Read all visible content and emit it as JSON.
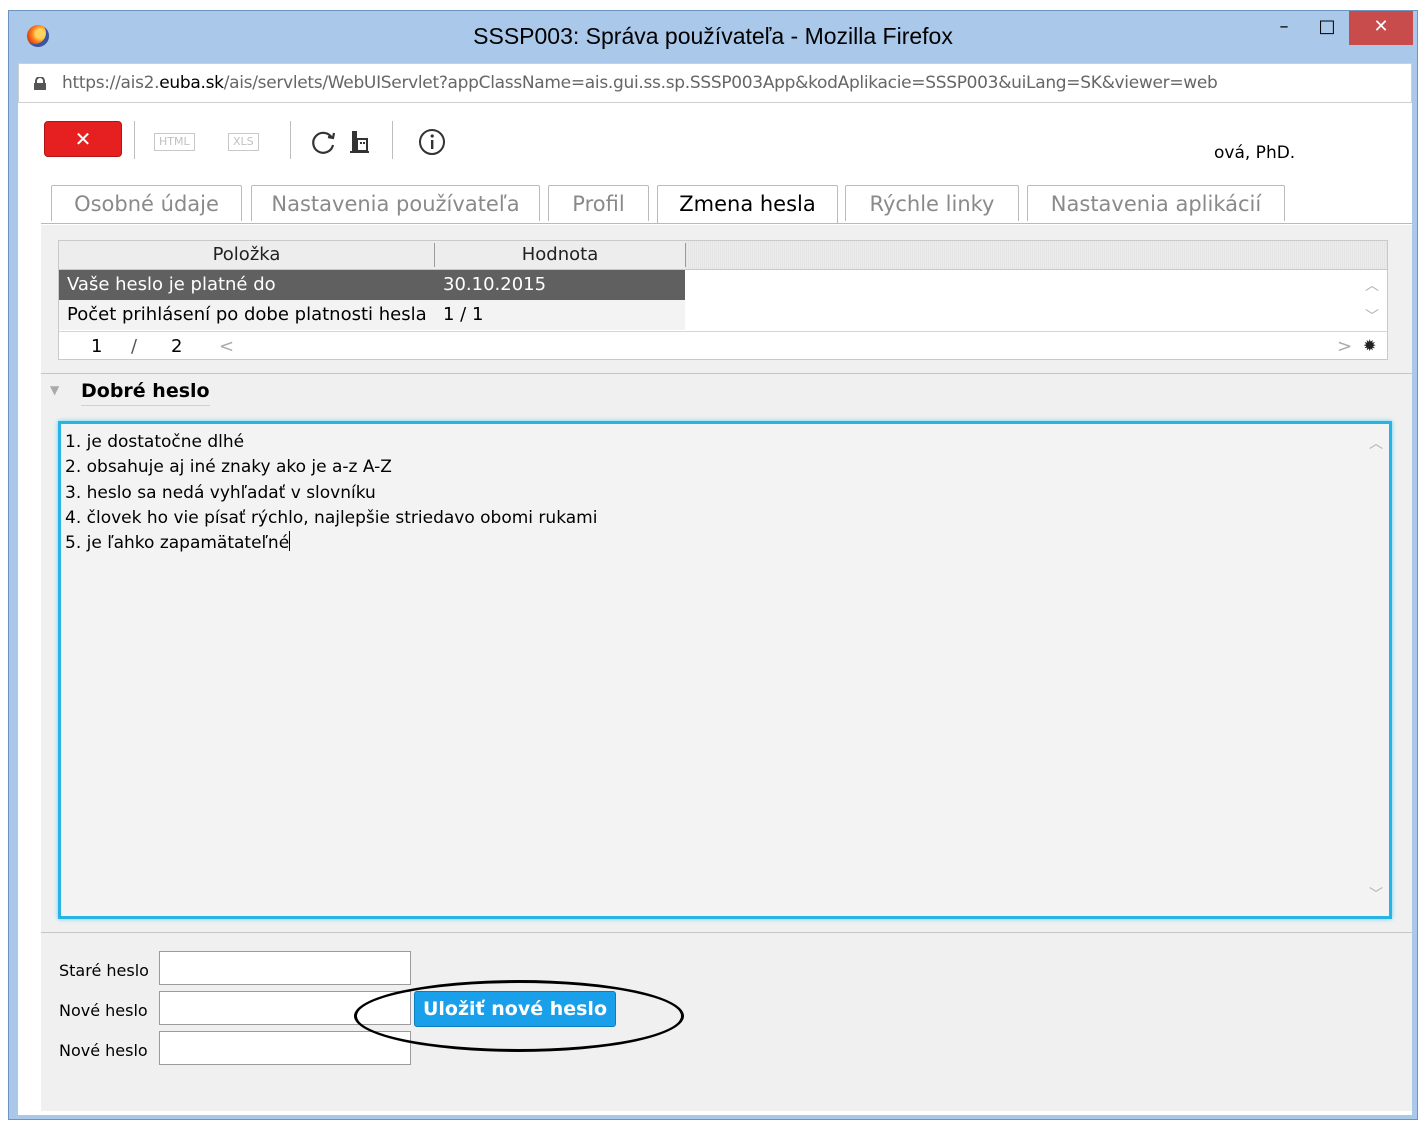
{
  "window": {
    "title": "SSSP003: Správa používateľa - Mozilla Firefox",
    "minimize": "–",
    "maximize": "□",
    "close": "✕"
  },
  "urlbar": {
    "url_prefix": "https://ais2.",
    "url_domain": "euba.sk",
    "url_suffix": "/ais/servlets/WebUIServlet?appClassName=ais.gui.ss.sp.SSSP003App&kodAplikacie=SSSP003&uiLang=SK&viewer=web"
  },
  "toolbar": {
    "close_label": "✕",
    "html_label": "HTML",
    "xls_label": "XLS",
    "icons": [
      "refresh-icon",
      "org-chart-icon",
      "info-icon"
    ],
    "user": "ová, PhD."
  },
  "tabs": [
    {
      "label": "Osobné údaje"
    },
    {
      "label": "Nastavenia používateľa"
    },
    {
      "label": "Profil"
    },
    {
      "label": "Zmena hesla"
    },
    {
      "label": "Rýchle linky"
    },
    {
      "label": "Nastavenia aplikácií"
    }
  ],
  "grid": {
    "columns": [
      "Položka",
      "Hodnota"
    ],
    "rows": [
      {
        "item": "Vaše heslo je platné do",
        "value": "30.10.2015"
      },
      {
        "item": "Počet prihlásení po dobe platnosti hesla",
        "value": "1 / 1"
      }
    ],
    "pager": {
      "current": "1",
      "sep": "/",
      "total": "2"
    }
  },
  "section": {
    "title": "Dobré heslo",
    "lines": [
      "1. je dostatočne dlhé",
      "2. obsahuje aj iné znaky ako je a-z A-Z",
      "3. heslo sa nedá vyhľadať v slovníku",
      "4. človek ho vie písať rýchlo, najlepšie striedavo obomi rukami",
      "5. je ľahko zapamätateľné"
    ]
  },
  "form": {
    "old_label": "Staré heslo",
    "new_label": "Nové heslo",
    "confirm_label": "Nové heslo",
    "old_value": "",
    "new_value": "",
    "confirm_value": "",
    "save_label": "Uložiť nové heslo"
  },
  "colors": {
    "accent": "#1aa0ea",
    "close": "#e62020",
    "focus": "#28b3e6"
  }
}
